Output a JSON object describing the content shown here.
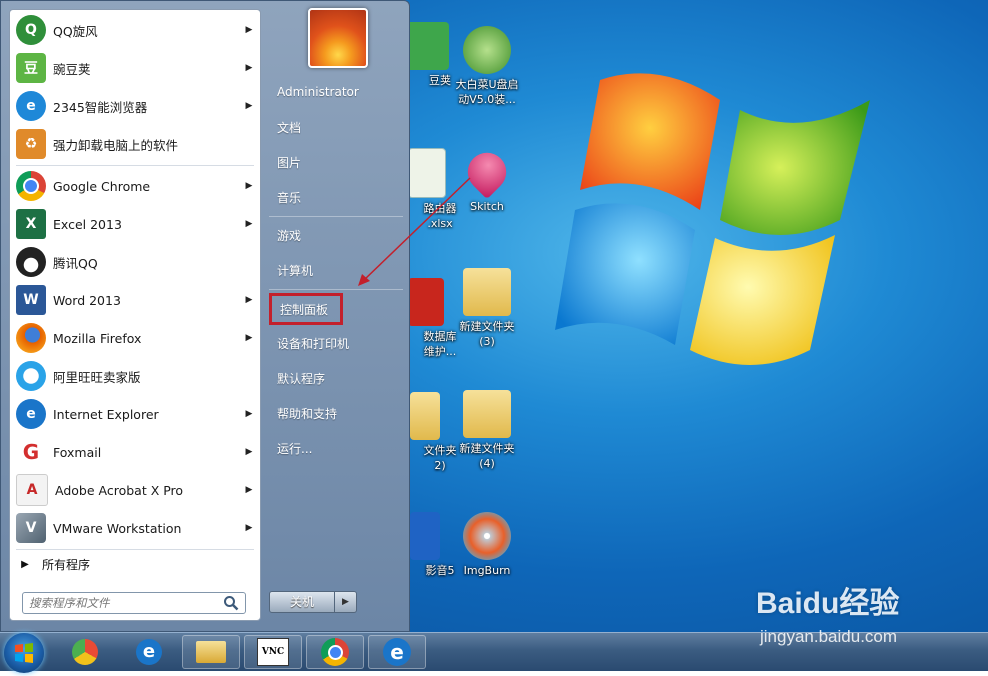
{
  "start_menu": {
    "programs": [
      {
        "label": "QQ旋风",
        "icon": "qq-whirlwind-icon",
        "submenu": true,
        "color": "#2f8f3a"
      },
      {
        "label": "豌豆荚",
        "icon": "wandoujia-icon",
        "submenu": true,
        "color": "#5db544"
      },
      {
        "label": "2345智能浏览器",
        "icon": "2345-browser-icon",
        "submenu": true,
        "color": "#1e88d8"
      },
      {
        "label": "强力卸载电脑上的软件",
        "icon": "uninstall-icon",
        "submenu": false,
        "color": "#e08a2a"
      },
      {
        "label": "Google Chrome",
        "icon": "chrome-icon",
        "submenu": true,
        "color": "#db4437"
      },
      {
        "label": "Excel 2013",
        "icon": "excel-icon",
        "submenu": true,
        "color": "#1d7044"
      },
      {
        "label": "腾讯QQ",
        "icon": "qq-penguin-icon",
        "submenu": false,
        "color": "#222222"
      },
      {
        "label": "Word 2013",
        "icon": "word-icon",
        "submenu": true,
        "color": "#2b5797"
      },
      {
        "label": "Mozilla Firefox",
        "icon": "firefox-icon",
        "submenu": true,
        "color": "#e66000"
      },
      {
        "label": "阿里旺旺卖家版",
        "icon": "aliwangwang-icon",
        "submenu": false,
        "color": "#2aa3e8"
      },
      {
        "label": "Internet Explorer",
        "icon": "ie-icon",
        "submenu": true,
        "color": "#1a75c9"
      },
      {
        "label": "Foxmail",
        "icon": "foxmail-icon",
        "submenu": true,
        "color": "#d32f2f"
      },
      {
        "label": "Adobe Acrobat X Pro",
        "icon": "acrobat-icon",
        "submenu": true,
        "color": "#c62828"
      },
      {
        "label": "VMware Workstation",
        "icon": "vmware-icon",
        "submenu": true,
        "color": "#607d8b"
      }
    ],
    "all_programs": "所有程序",
    "search_placeholder": "搜索程序和文件",
    "right_items": [
      {
        "label": "Administrator"
      },
      {
        "label": "文档"
      },
      {
        "label": "图片"
      },
      {
        "label": "音乐"
      },
      {
        "label": "游戏"
      },
      {
        "label": "计算机"
      },
      {
        "label": "控制面板",
        "highlighted": true
      },
      {
        "label": "设备和打印机"
      },
      {
        "label": "默认程序"
      },
      {
        "label": "帮助和支持"
      },
      {
        "label": "运行..."
      }
    ],
    "shutdown_label": "关机"
  },
  "desktop_icons": [
    {
      "line1": "豆荚",
      "line2": "",
      "icon": "wandoujia-desktop-icon"
    },
    {
      "line1": "大白菜U盘启",
      "line2": "动V5.0装...",
      "icon": "dabaicai-icon"
    },
    {
      "line1": "路由器",
      "line2": ".xlsx",
      "icon": "xlsx-file-icon"
    },
    {
      "line1": "Skitch",
      "line2": "",
      "icon": "skitch-heart-icon"
    },
    {
      "line1": "数据库",
      "line2": "维护...",
      "icon": "ppt-file-icon"
    },
    {
      "line1": "新建文件夹",
      "line2": "(3)",
      "icon": "folder-icon"
    },
    {
      "line1": "文件夹",
      "line2": "2)",
      "icon": "folder-icon"
    },
    {
      "line1": "新建文件夹",
      "line2": "(4)",
      "icon": "folder-icon"
    },
    {
      "line1": "影音5",
      "line2": "",
      "icon": "media-player-icon"
    },
    {
      "line1": "ImgBurn",
      "line2": "",
      "icon": "imgburn-icon"
    }
  ],
  "watermark": {
    "logo": "Baidu经验",
    "url": "jingyan.baidu.com"
  },
  "taskbar": {
    "buttons": [
      {
        "name": "start-orb"
      },
      {
        "name": "360-icon"
      },
      {
        "name": "ie-taskbar-icon"
      },
      {
        "name": "explorer-folder-icon"
      },
      {
        "name": "vnc-icon"
      },
      {
        "name": "chrome-taskbar-icon"
      },
      {
        "name": "ie-taskbar-icon-2"
      }
    ],
    "vnc_label": "VNC"
  }
}
